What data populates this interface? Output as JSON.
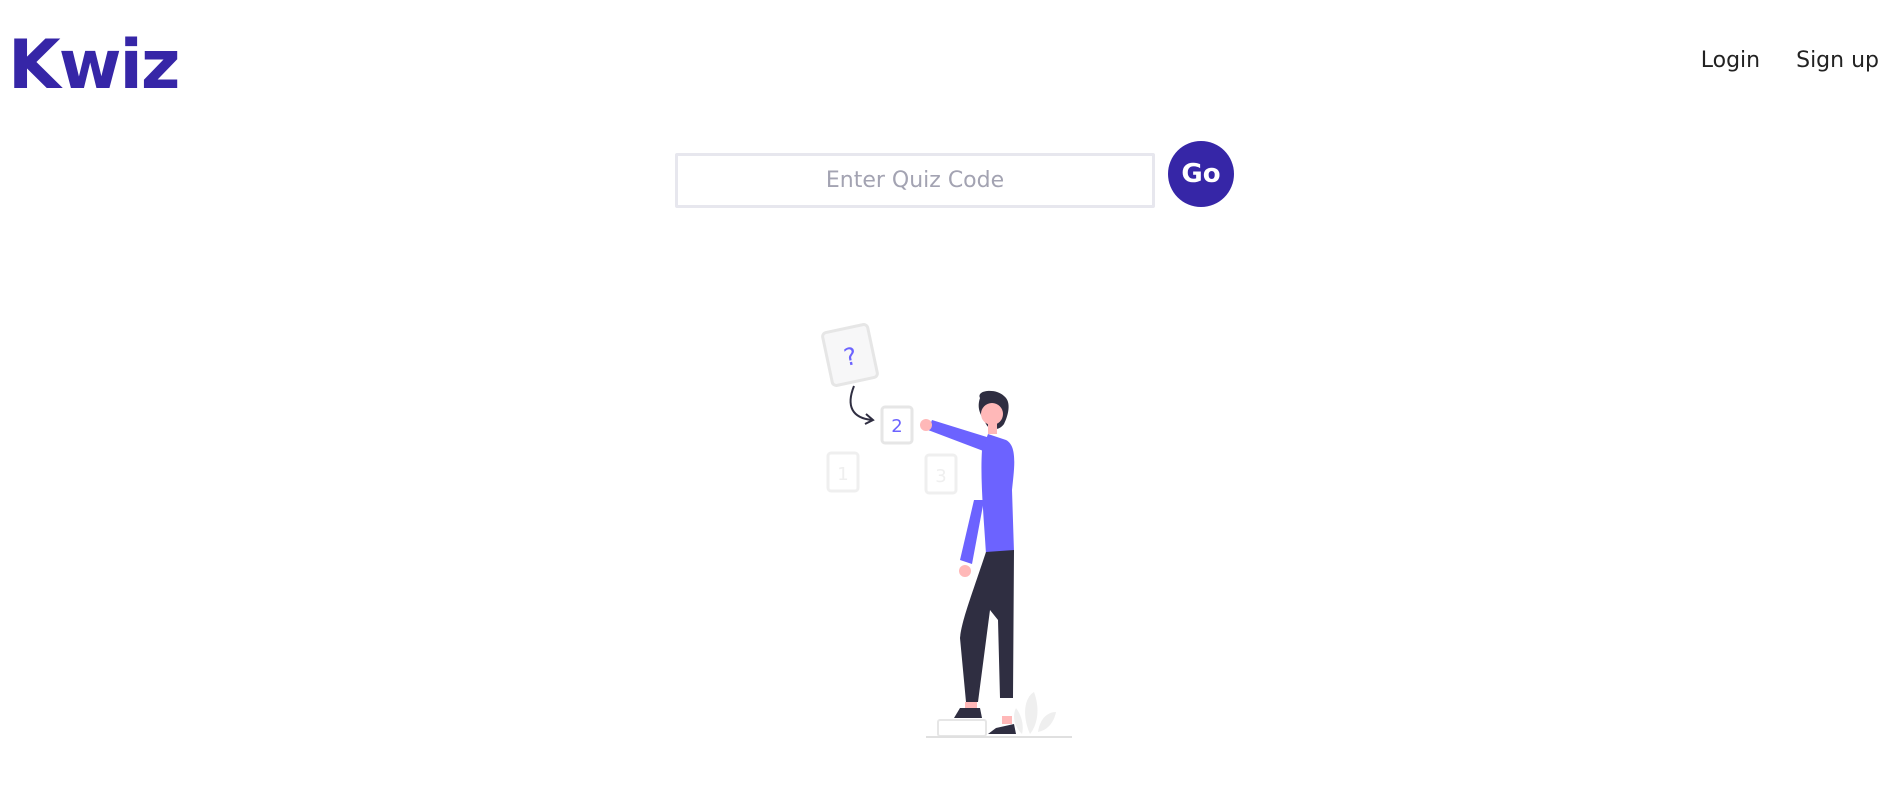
{
  "brand": {
    "name": "Kwiz",
    "color": "#3626a7"
  },
  "nav": {
    "login_label": "Login",
    "signup_label": "Sign up"
  },
  "quiz_entry": {
    "placeholder": "Enter Quiz Code",
    "value": "",
    "go_label": "Go"
  },
  "illustration": {
    "question_card_glyph": "?",
    "card_1_glyph": "1",
    "card_2_glyph": "2",
    "card_3_glyph": "3",
    "accent_color": "#6c63ff",
    "dark_color": "#2f2e41",
    "skin_color": "#ffb8b8"
  }
}
